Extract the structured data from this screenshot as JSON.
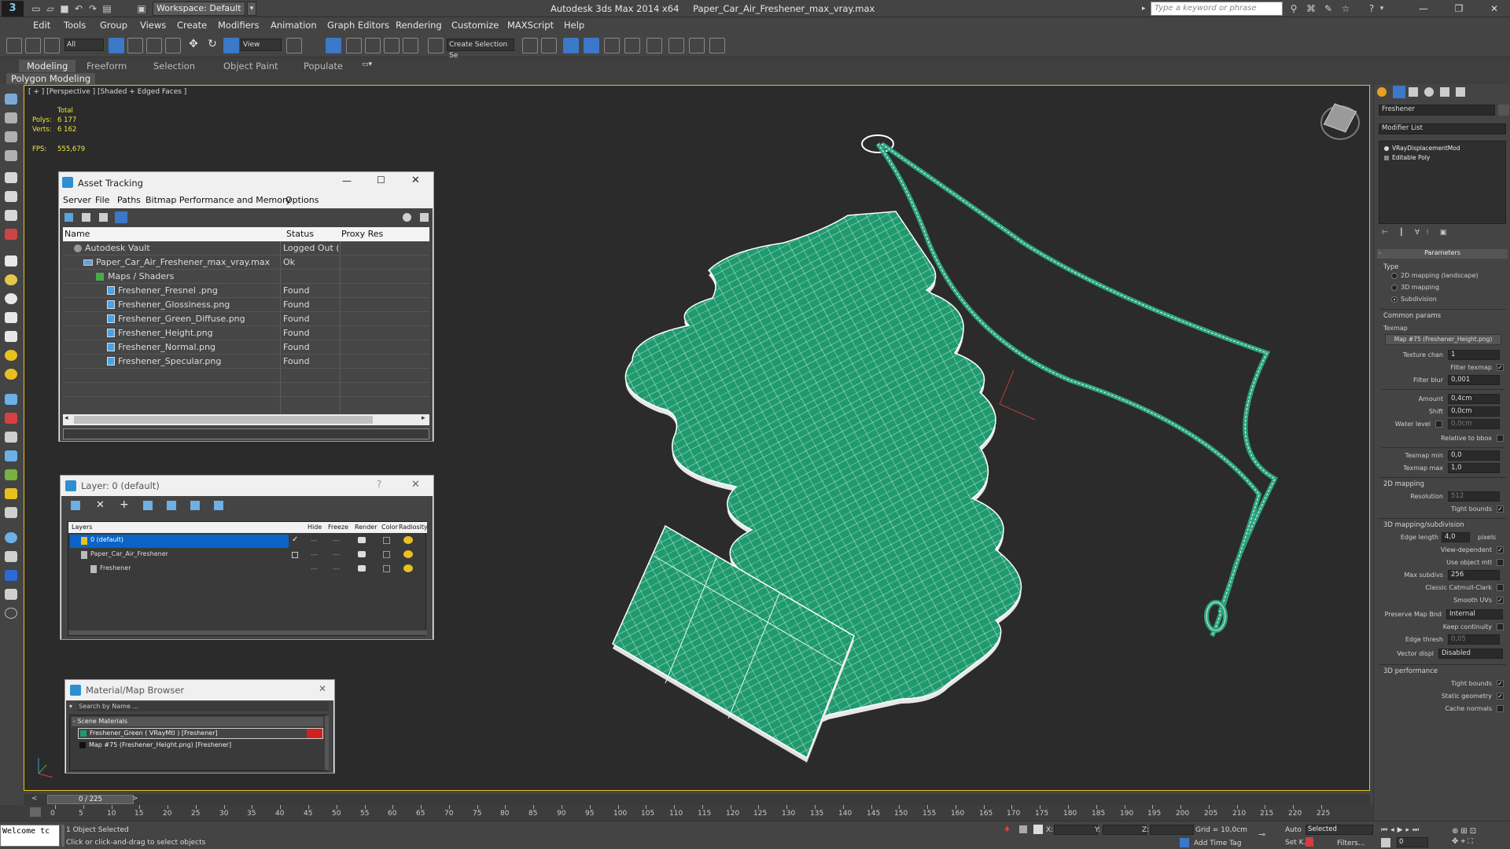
{
  "window": {
    "workspace": "Workspace: Default",
    "app_name": "Autodesk 3ds Max  2014 x64",
    "file_name": "Paper_Car_Air_Freshener_max_vray.max",
    "search_placeholder": "Type a keyword or phrase"
  },
  "menu": [
    "Edit",
    "Tools",
    "Group",
    "Views",
    "Create",
    "Modifiers",
    "Animation",
    "Graph Editors",
    "Rendering",
    "Customize",
    "MAXScript",
    "Help"
  ],
  "toolbar": {
    "selection_filter": "All",
    "ref_coord": "View",
    "named_selection": "Create Selection Se"
  },
  "ribbon": {
    "tabs": [
      "Modeling",
      "Freeform",
      "Selection",
      "Object Paint",
      "Populate"
    ],
    "sub_label": "Polygon Modeling"
  },
  "viewport": {
    "label": "[ + ] [Perspective ] [Shaded + Edged Faces ]",
    "stats_total": "Total",
    "polys_label": "Polys:",
    "polys_value": "6 177",
    "verts_label": "Verts:",
    "verts_value": "6 162",
    "fps_label": "FPS:",
    "fps_value": "555,679"
  },
  "asset_tracking": {
    "title": "Asset Tracking",
    "menus": [
      "Server",
      "File",
      "Paths",
      "Bitmap Performance and Memory",
      "Options"
    ],
    "columns": [
      "Name",
      "Status",
      "Proxy Res"
    ],
    "rows": [
      {
        "name": "Autodesk Vault",
        "status": "Logged Out (..."
      },
      {
        "name": "Paper_Car_Air_Freshener_max_vray.max",
        "status": "Ok"
      },
      {
        "name": "Maps / Shaders",
        "status": ""
      },
      {
        "name": "Freshener_Fresnel .png",
        "status": "Found"
      },
      {
        "name": "Freshener_Glossiness.png",
        "status": "Found"
      },
      {
        "name": "Freshener_Green_Diffuse.png",
        "status": "Found"
      },
      {
        "name": "Freshener_Height.png",
        "status": "Found"
      },
      {
        "name": "Freshener_Normal.png",
        "status": "Found"
      },
      {
        "name": "Freshener_Specular.png",
        "status": "Found"
      }
    ]
  },
  "layer_dialog": {
    "title": "Layer: 0 (default)",
    "help": "?",
    "columns": [
      "Layers",
      "Hide",
      "Freeze",
      "Render",
      "Color",
      "Radiosity"
    ],
    "rows": [
      {
        "name": "0 (default)",
        "color": "#2a6bd6"
      },
      {
        "name": "Paper_Car_Air_Freshener",
        "color": "#c0201a"
      },
      {
        "name": "Freshener",
        "color": "#111111"
      }
    ]
  },
  "material_browser": {
    "title": "Material/Map Browser",
    "search_placeholder": "Search by Name ...",
    "group": "- Scene Materials",
    "items": [
      "Freshener_Green  ( VRayMtl )  [Freshener]",
      "Map #75 (Freshener_Height.png)  [Freshener]"
    ]
  },
  "command_panel": {
    "object_name": "Freshener",
    "modifier_list": "Modifier List",
    "stack": [
      "VRayDisplacementMod",
      "Editable Poly"
    ],
    "rollout": "Parameters",
    "type_label": "Type",
    "types": [
      "2D mapping (landscape)",
      "3D mapping",
      "Subdivision"
    ],
    "common_params": "Common params",
    "texmap_label": "Texmap",
    "texmap_value": "Map #75 (Freshener_Height.png)",
    "texture_chan_label": "Texture chan",
    "texture_chan_value": "1",
    "filter_texmap": "Filter texmap",
    "filter_blur_label": "Filter blur",
    "filter_blur_value": "0,001",
    "amount_label": "Amount",
    "amount_value": "0,4cm",
    "shift_label": "Shift",
    "shift_value": "0,0cm",
    "water_label": "Water level",
    "water_value": "0,0cm",
    "relative_bbox": "Relative to bbox",
    "texmap_min_label": "Texmap min",
    "texmap_min_value": "0,0",
    "texmap_max_label": "Texmap max",
    "texmap_max_value": "1,0",
    "mapping_2d": "2D mapping",
    "resolution_label": "Resolution",
    "resolution_value": "512",
    "tight_bounds": "Tight bounds",
    "mapping_3d": "3D mapping/subdivision",
    "edge_length_label": "Edge length",
    "edge_length_value": "4,0",
    "edge_length_unit": "pixels",
    "view_dependent": "View-dependent",
    "use_object_mtl": "Use object mtl",
    "max_subdivs_label": "Max subdivs",
    "max_subdivs_value": "256",
    "classic_catmull": "Classic Catmull-Clark",
    "smooth_uvs": "Smooth UVs",
    "preserve_label": "Preserve Map Bnd",
    "preserve_value": "Internal",
    "keep_continuity": "Keep continuity",
    "edge_thresh_label": "Edge thresh",
    "edge_thresh_value": "0,05",
    "vector_displ_label": "Vector displ",
    "vector_displ_value": "Disabled",
    "performance": "3D performance",
    "tight_bounds2": "Tight bounds",
    "static_geometry": "Static geometry",
    "cache_normals": "Cache normals"
  },
  "timeline": {
    "frame_counter": "0 / 225",
    "ticks": [
      "0",
      "5",
      "10",
      "15",
      "20",
      "25",
      "30",
      "35",
      "40",
      "45",
      "50",
      "55",
      "60",
      "65",
      "70",
      "75",
      "80",
      "85",
      "90",
      "95",
      "100",
      "105",
      "110",
      "115",
      "120",
      "125",
      "130",
      "135",
      "140",
      "145",
      "150",
      "155",
      "160",
      "165",
      "170",
      "175",
      "180",
      "185",
      "190",
      "195",
      "200",
      "205",
      "210",
      "215",
      "220",
      "225"
    ]
  },
  "status": {
    "maxscript": "Welcome tc",
    "selected": "1 Object Selected",
    "prompt": "Click or click-and-drag to select objects",
    "x_label": "X:",
    "y_label": "Y:",
    "z_label": "Z:",
    "grid": "Grid = 10,0cm",
    "add_time_tag": "Add Time Tag",
    "auto": "Auto",
    "set_key": "Set K.",
    "selected_dropdown": "Selected",
    "filters": "Filters...",
    "frame": "0"
  },
  "colors": {
    "model_green": "#1f9a6e",
    "selection_blue": "#0a64c8",
    "viewport_border": "#e8c020"
  }
}
